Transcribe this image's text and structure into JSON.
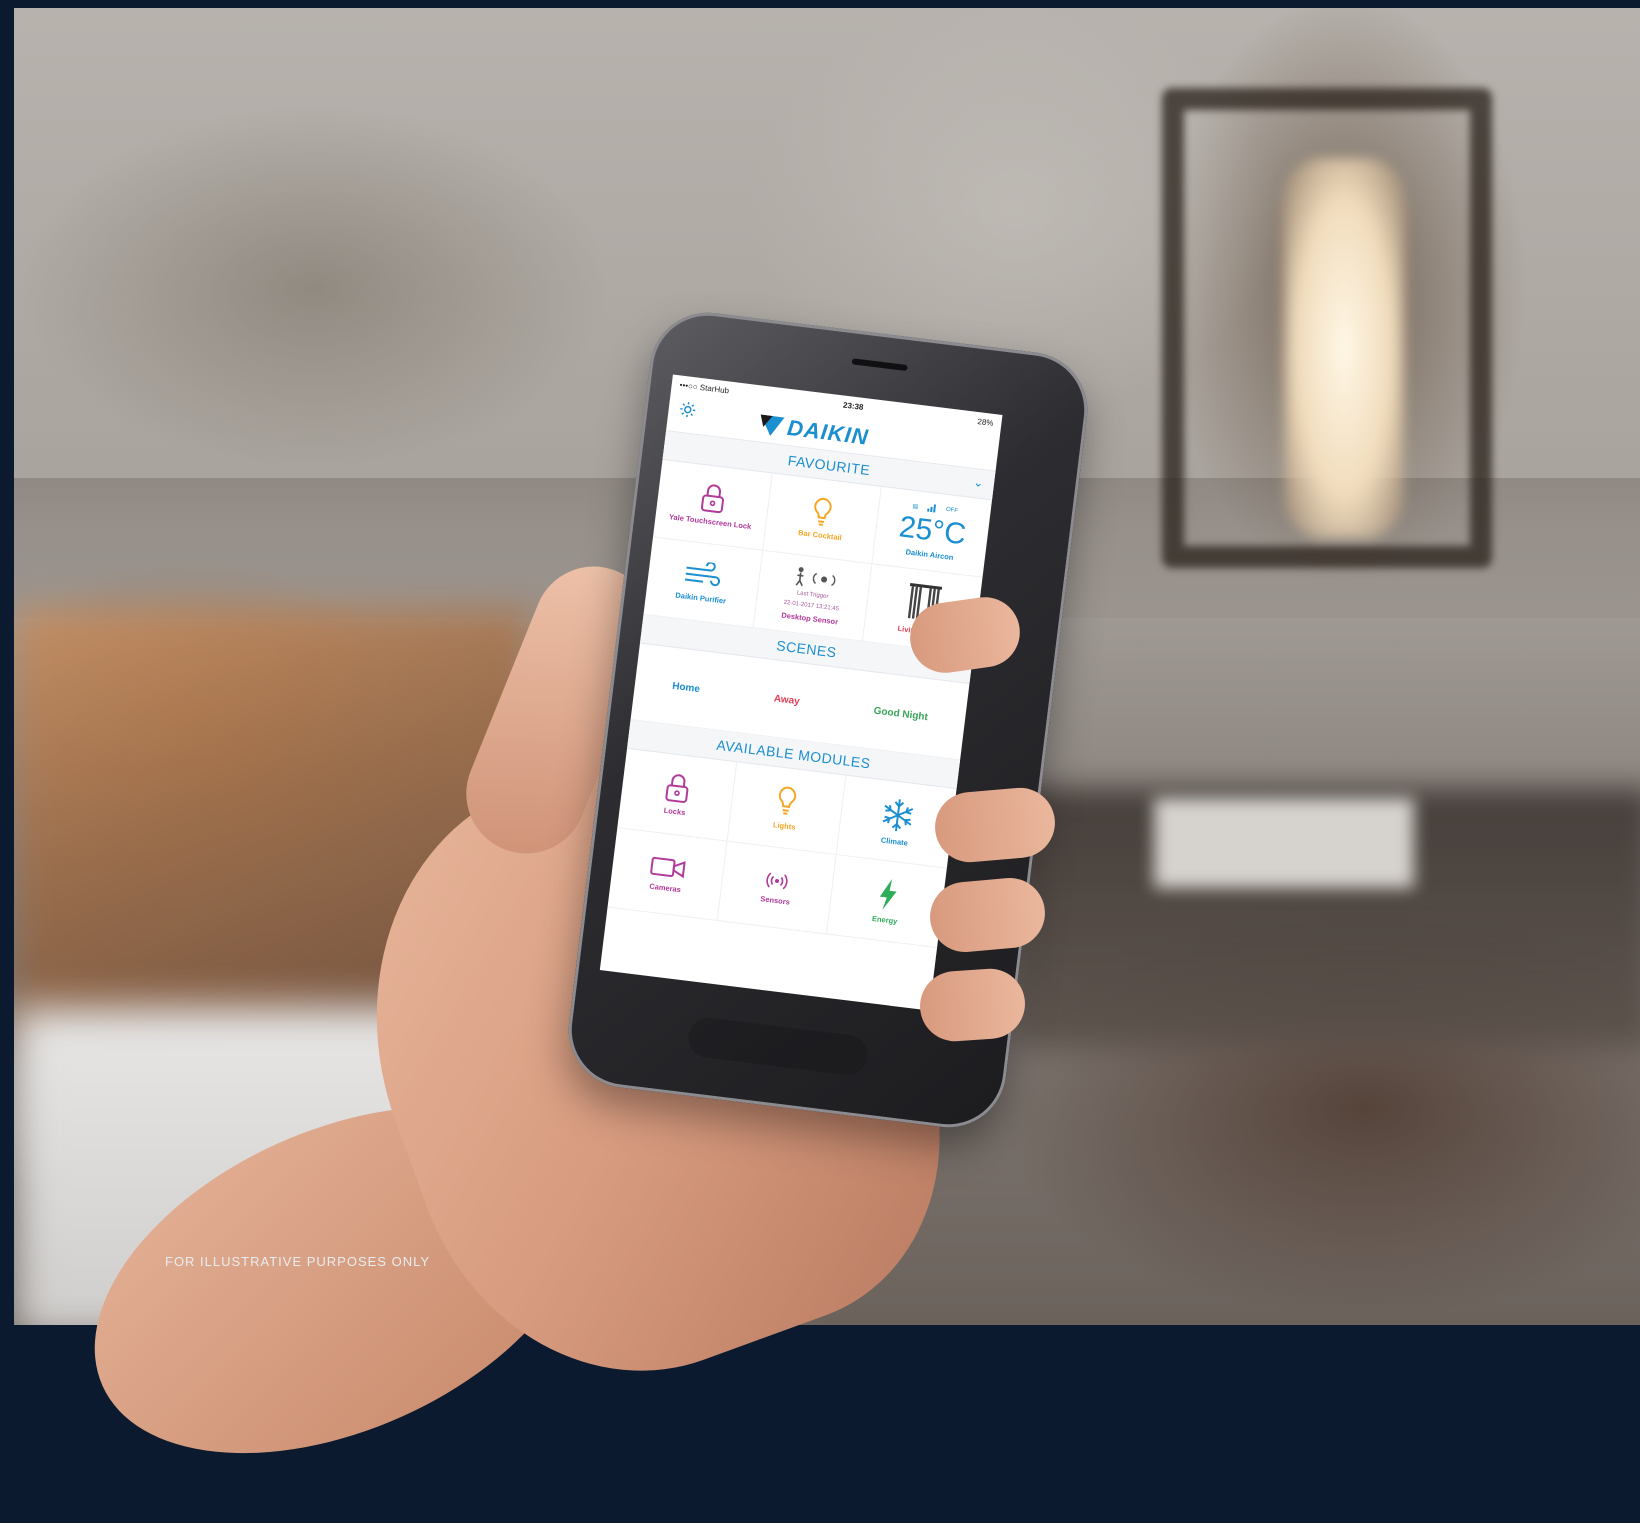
{
  "caption": "FOR ILLUSTRATIVE PURPOSES ONLY",
  "colors": {
    "brand_blue": "#1b8fd0",
    "magenta": "#b23a9a",
    "orange": "#f5a623",
    "red": "#e0405a",
    "green": "#3aa35a",
    "energy_green": "#2fae5a"
  },
  "phone": {
    "status": {
      "carrier": "•••○○ StarHub",
      "time": "23:38",
      "battery": "28%"
    },
    "header": {
      "brand": "DAIKIN",
      "settings_icon": "gear-icon"
    },
    "favourite": {
      "title": "FAVOURITE",
      "chevron_icon": "chevron-down-icon",
      "tiles": [
        {
          "label": "Yale Touchscreen Lock",
          "icon": "padlock-icon",
          "color": "#b23a9a"
        },
        {
          "label": "Bar Cocktail",
          "icon": "lightbulb-icon",
          "color": "#f5a623"
        },
        {
          "label": "Daikin Aircon",
          "temperature": "25°C",
          "status": "OFF",
          "color": "#1b8fd0"
        },
        {
          "label": "Daikin Purifier",
          "icon": "wind-icon",
          "color": "#1b8fd0"
        },
        {
          "label": "Desktop Sensor",
          "sub": "Last Trigger",
          "sub_time": "22-01-2017 13:21:45",
          "icon": "motion-sensor-icon",
          "color": "#b23a9a"
        },
        {
          "label": "Living Room",
          "icon": "curtain-icon",
          "color": "#e0405a"
        }
      ]
    },
    "scenes": {
      "title": "SCENES",
      "chevron_icon": "chevron-right-icon",
      "items": [
        {
          "label": "Home",
          "color": "#1b8fd0"
        },
        {
          "label": "Away",
          "color": "#e0405a"
        },
        {
          "label": "Good Night",
          "color": "#3aa35a"
        }
      ]
    },
    "modules": {
      "title": "AVAILABLE MODULES",
      "tiles": [
        {
          "label": "Locks",
          "icon": "padlock-icon",
          "color": "#b23a9a"
        },
        {
          "label": "Lights",
          "icon": "lightbulb-icon",
          "color": "#f5a623"
        },
        {
          "label": "Climate",
          "icon": "snowflake-icon",
          "color": "#1b8fd0"
        },
        {
          "label": "Cameras",
          "icon": "video-camera-icon",
          "color": "#b23a9a"
        },
        {
          "label": "Sensors",
          "icon": "sensor-waves-icon",
          "color": "#b23a9a"
        },
        {
          "label": "Energy",
          "icon": "lightning-bolt-icon",
          "color": "#2fae5a"
        }
      ]
    }
  }
}
